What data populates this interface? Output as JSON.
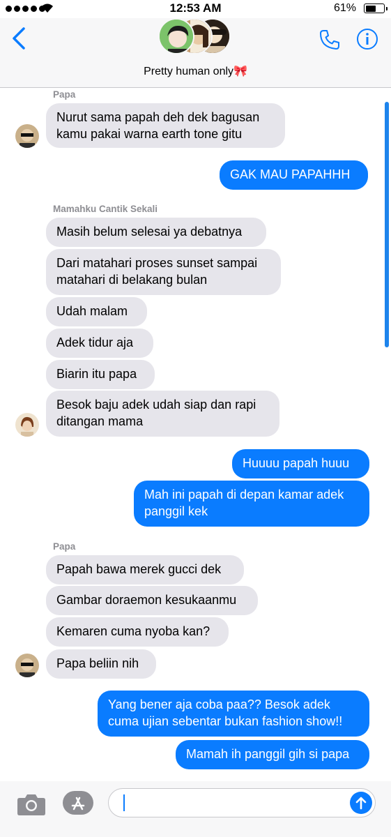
{
  "status": {
    "time": "12:53 AM",
    "battery": "61%",
    "battery_level": 0.61
  },
  "nav": {
    "title": "Pretty human only🎀"
  },
  "thread": {
    "papa_label_1": "Papa",
    "m1": "Nurut sama papah deh dek bagusan",
    "m1b": "kamu pakai warna earth tone gitu",
    "m2": "GAK MAU PAPAHHH",
    "mama_label": "Mamahku Cantik Sekali",
    "m3": "Masih belum selesai ya debatnya",
    "m4": "Dari matahari proses sunset sampai",
    "m4b": "matahari di belakang bulan",
    "m5": "Udah malam",
    "m6": "Adek tidur aja",
    "m7": "Biarin itu papa",
    "m8": "Besok baju adek udah siap dan rapi",
    "m8b": "ditangan mama",
    "m9": "Huuuu papah huuu",
    "m10": "Mah ini papah di depan kamar adek",
    "m10b": "panggil kek",
    "papa_label_2": "Papa",
    "m11": "Papah bawa merek gucci dek",
    "m12": "Gambar doraemon kesukaanmu",
    "m13": "Kemaren cuma nyoba kan?",
    "m14": "Papa beliin nih",
    "m15": "Yang bener aja coba paa?? Besok adek",
    "m15b": "cuma ujian sebentar bukan fashion show!!",
    "m16": "Mamah ih panggil gih si papa"
  },
  "composer": {
    "input_value": ""
  },
  "colors": {
    "accent": "#0a7cff",
    "incoming": "#e6e5eb",
    "outgoing": "#0a7cff"
  }
}
